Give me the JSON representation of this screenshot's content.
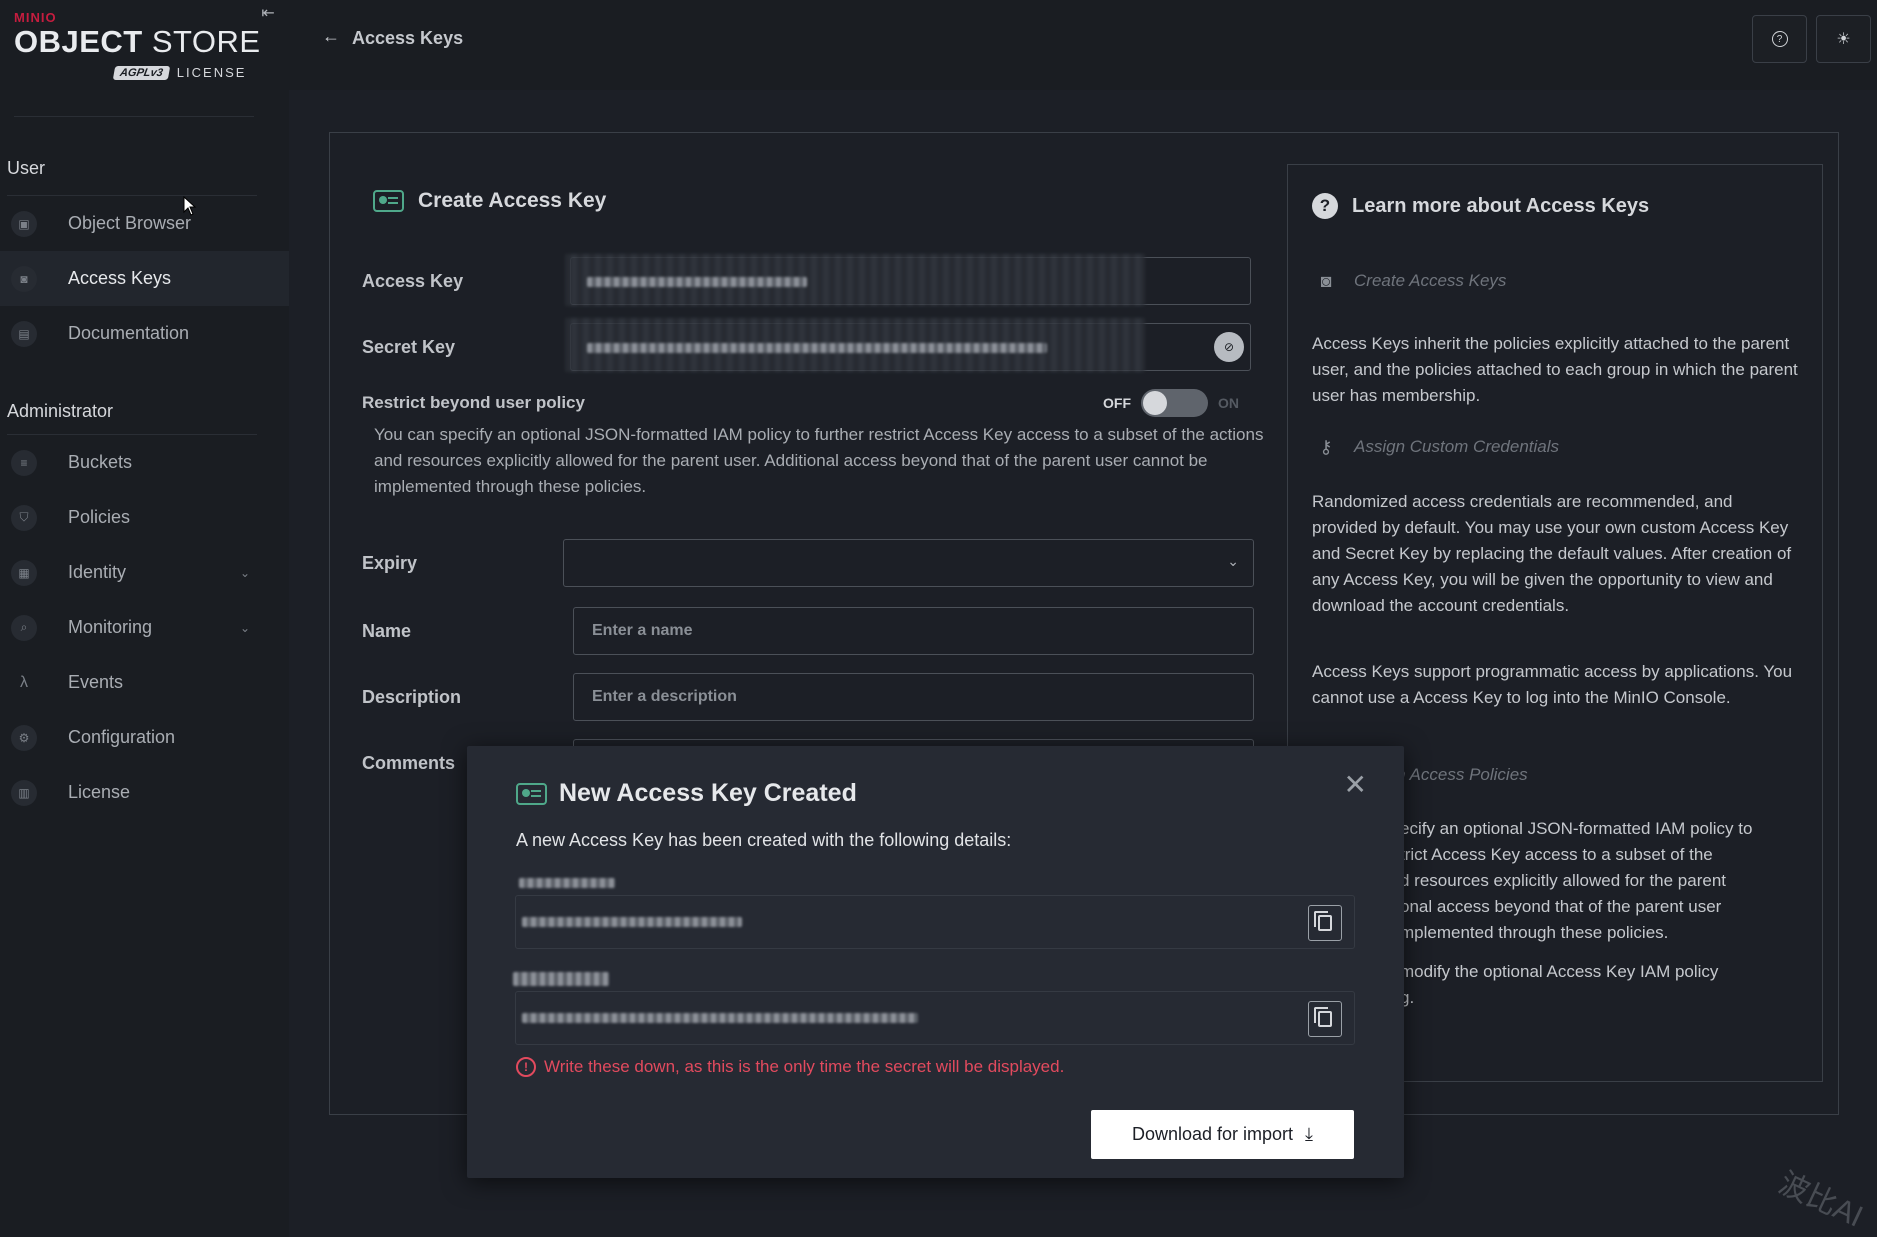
{
  "logo": {
    "brand": "MINIO",
    "product_bold": "OBJECT",
    "product_thin": "STORE",
    "badge": "AGPLv3",
    "license": "LICENSE"
  },
  "sidebar": {
    "sections": [
      {
        "title": "User",
        "items": [
          {
            "label": "Object Browser",
            "icon": "object-browser-icon",
            "active": false
          },
          {
            "label": "Access Keys",
            "icon": "access-keys-icon",
            "active": true
          },
          {
            "label": "Documentation",
            "icon": "documentation-icon",
            "active": false
          }
        ]
      },
      {
        "title": "Administrator",
        "items": [
          {
            "label": "Buckets",
            "icon": "bucket-icon"
          },
          {
            "label": "Policies",
            "icon": "shield-icon"
          },
          {
            "label": "Identity",
            "icon": "identity-icon",
            "expandable": true
          },
          {
            "label": "Monitoring",
            "icon": "monitoring-icon",
            "expandable": true
          },
          {
            "label": "Events",
            "icon": "lambda-icon"
          },
          {
            "label": "Configuration",
            "icon": "gear-icon"
          },
          {
            "label": "License",
            "icon": "license-icon"
          }
        ]
      }
    ]
  },
  "header": {
    "back_glyph": "←",
    "title": "Access Keys",
    "help_icon": "help-icon",
    "theme_icon": "sun-icon"
  },
  "form": {
    "title": "Create Access Key",
    "access_key_label": "Access Key",
    "secret_key_label": "Secret Key",
    "restrict_label": "Restrict beyond user policy",
    "toggle_off": "OFF",
    "toggle_on": "ON",
    "toggle_state": "off",
    "restrict_help": "You can specify an optional JSON-formatted IAM policy to further restrict Access Key access to a subset of the actions and resources explicitly allowed for the parent user. Additional access beyond that of the parent user cannot be implemented through these policies.",
    "expiry_label": "Expiry",
    "expiry_value": "",
    "name_label": "Name",
    "name_placeholder": "Enter a name",
    "description_label": "Description",
    "description_placeholder": "Enter a description",
    "comments_label": "Comments"
  },
  "info": {
    "title": "Learn more about Access Keys",
    "sub1": "Create Access Keys",
    "para1": "Access Keys inherit the policies explicitly attached to the parent user, and the policies attached to each group in which the parent user has membership.",
    "sub2": "Assign Custom Credentials",
    "para2": "Randomized access credentials are recommended, and provided by default. You may use your own custom Access Key and Secret Key by replacing the default values. After creation of any Access Key, you will be given the opportunity to view and download the account credentials.",
    "para3": "Access Keys support programmatic access by applications. You cannot use a Access Key to log into the MinIO Console.",
    "sub3": "n Access Policies",
    "para4_lines": [
      "ecify an optional JSON-formatted IAM policy to",
      "trict Access Key access to a subset of the",
      "d resources explicitly allowed for the parent",
      "onal access beyond that of the parent user",
      "mplemented through these policies."
    ],
    "para5_lines": [
      "modify the optional Access Key IAM policy",
      "g."
    ]
  },
  "modal": {
    "title": "New Access Key Created",
    "subtitle": "A new Access Key has been created with the following details:",
    "warning": "Write these down, as this is the only time the secret will be displayed.",
    "download_label": "Download for import",
    "close_glyph": "✕"
  },
  "watermark": "波比AI",
  "colors": {
    "accent_green": "#4fa88a",
    "warning_red": "#e24a5e",
    "background": "#1c1f26",
    "sidebar": "#1a1d22"
  }
}
